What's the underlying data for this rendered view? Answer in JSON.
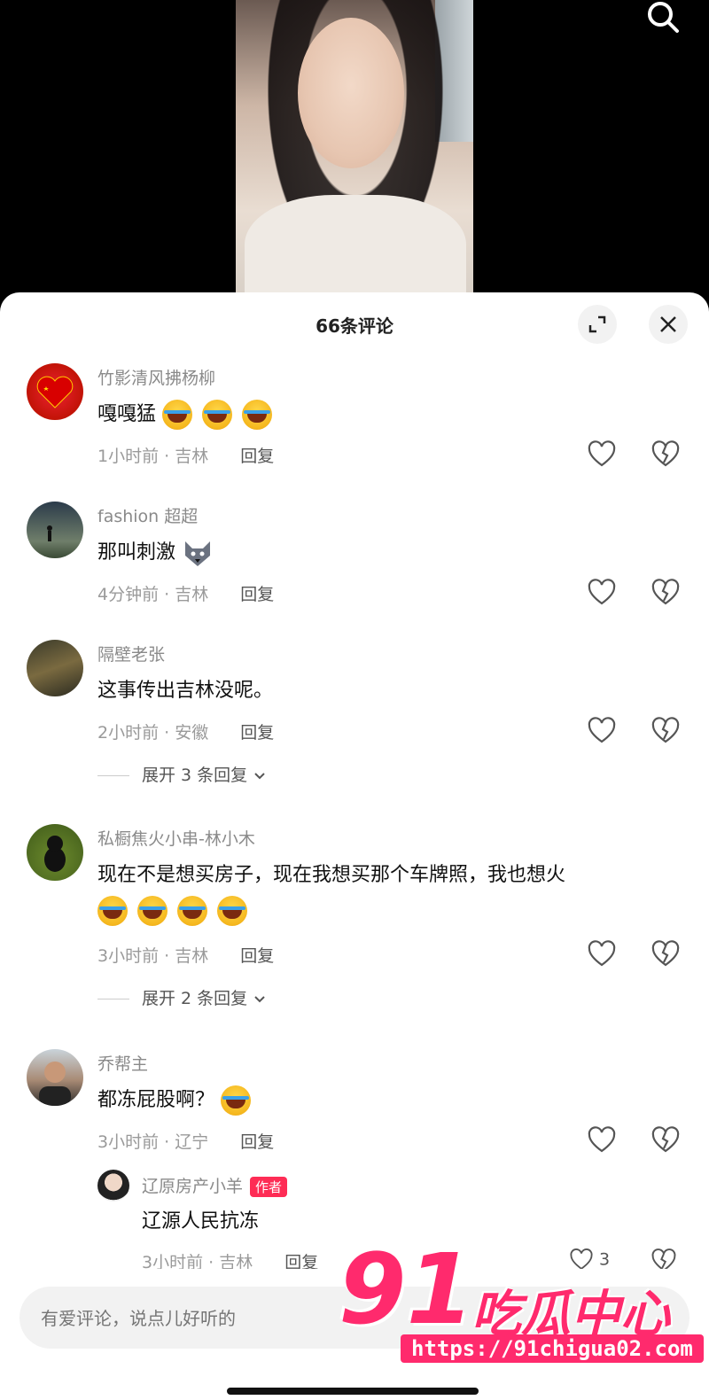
{
  "header": {
    "comment_count_title": "66条评论"
  },
  "icons": {
    "search": "search-icon",
    "expand": "expand-icon",
    "close": "close-icon",
    "like": "heart-icon",
    "dislike": "broken-heart-icon"
  },
  "comments": [
    {
      "username": "竹影清风拂杨柳",
      "text": "嘎嘎猛",
      "emoji_count": 3,
      "time": "1小时前",
      "location": "吉林",
      "reply_label": "回复"
    },
    {
      "username": "fashion 超超",
      "text": "那叫刺激",
      "time": "4分钟前",
      "location": "吉林",
      "reply_label": "回复"
    },
    {
      "username": "隔壁老张",
      "text": "这事传出吉林没呢。",
      "time": "2小时前",
      "location": "安徽",
      "reply_label": "回复",
      "expand_label": "展开 3 条回复"
    },
    {
      "username": "私橱焦火小串-林小木",
      "text": "现在不是想买房子，现在我想买那个车牌照，我也想火",
      "emoji_count": 4,
      "time": "3小时前",
      "location": "吉林",
      "reply_label": "回复",
      "expand_label": "展开 2 条回复"
    },
    {
      "username": "乔帮主",
      "text": "都冻屁股啊？",
      "emoji_count": 1,
      "time": "3小时前",
      "location": "辽宁",
      "reply_label": "回复"
    }
  ],
  "sub_reply": {
    "username": "辽原房产小羊",
    "author_tag": "作者",
    "text": "辽源人民抗冻",
    "time": "3小时前",
    "location": "吉林",
    "reply_label": "回复",
    "like_count": "3"
  },
  "meta_separator": "·",
  "input": {
    "placeholder": "有爱评论，说点儿好听的"
  },
  "watermark": {
    "big": "91",
    "text": "吃瓜中心",
    "url": "https://91chigua02.com"
  },
  "colors": {
    "accent": "#fe2c55",
    "watermark": "#ff2a6d"
  }
}
